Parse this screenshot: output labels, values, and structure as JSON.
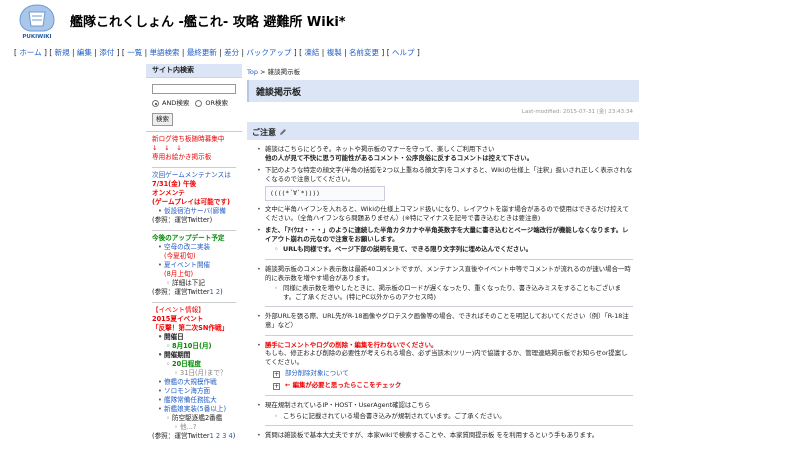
{
  "header": {
    "logo_text": "PUKIWIKI",
    "site_title": "艦隊これくしょん -艦これ- 攻略 避難所 Wiki*"
  },
  "navbar": [
    "ホーム",
    "新規",
    "編集",
    "添付",
    "一覧",
    "単語検索",
    "最終更新",
    "差分",
    "バックアップ",
    "凍結",
    "複製",
    "名前変更",
    "ヘルプ"
  ],
  "sidebar": {
    "search_heading": "サイト内検索",
    "and_label": "AND検索",
    "or_label": "OR検索",
    "search_button": "検索",
    "recruit_line1": "新ログ待ち板随時募集中",
    "recruit_arrows": "↓　↓　↓",
    "recruit_link": "専用お絵かき掲示板",
    "maint_title": "次回ゲームメンテナンスは",
    "maint_date": "7/31(金) 午後",
    "online_title": "オンメンテ",
    "online_note": "(ゲームプレイは可能です)",
    "temp_server": "仮設宿泊サーバ(廊備",
    "source1": "(参照：運営Twitter)",
    "update_title": "今後のアップデート予定",
    "update_item1": "空母の改二実装",
    "update_item1_note": "(今夏初旬)",
    "update_item2": "夏イベント開催",
    "update_item2_note": "(8月上旬)",
    "update_detail": "詳細は下記",
    "source2_prefix": "(参照：運営Twitter",
    "source2_links": "1 2",
    "source2_suffix": ")",
    "event_info": "【イベント情報】",
    "event_title": "2015夏イベント",
    "event_name": "「反撃！第二次SN作戦」",
    "period_label": "開催日",
    "period_date": "8月10日(月)",
    "period_end_label": "開催期間",
    "period_days": "20日程度",
    "period_until": "31日(月)まで？",
    "item_a": "僚艦の大規模作戦",
    "item_b": "ソロモン海方面",
    "item_c": "艦隊常備任務拡大",
    "item_d": "新艦娘実装(5番以上)",
    "item_e": "防空駆逐艦2番艦",
    "item_e_note": "他...?",
    "source3_prefix": "(参照：運営Twitter",
    "source3_links": "1 2 3 4",
    "source3_suffix": ")"
  },
  "main": {
    "breadcrumb_top": "Top",
    "breadcrumb_sep": " > ",
    "breadcrumb_page": "雑談掲示板",
    "page_title": "雑談掲示板",
    "last_modified": "Last-modified: 2015-07-31 (金) 23:43:34",
    "notice_heading": "ご注意",
    "p1_line1": "雑談はこちらにどうぞ。ネットや掲示板のマナーを守って、楽しくご利用下さい",
    "p1_line2": "他の人が見て不快に思う可能性があるコメント・公序良俗に反するコメントは控えて下さい。",
    "p2_text": "下記のような特定の顔文字(半角の括弧を2つ以上重ねる顔文字)をコメすると、Wikiの仕様上「注釈」扱いされ正しく表示されなくなるので注意してください。",
    "code_sample": "((((*´∀`*))))",
    "p3_text": "文中に半角ハイフンを入れると、Wikiの仕様上コマンド扱いになり、レイアウトを崩す場合があるので使用はできるだけ控えてください。（全角ハイフンなら問題ありません）(※特にマイナスを記号で書き込むときは要注意)",
    "p4_text": "また、「ｱｲｳｴｵ・・・」のように連続した半角カタカナや半角英数字を大量に書き込むとページ端改行が機能しなくなります。レイアウト崩れの元なので注意をお願いします。",
    "p4_sub": "URLも同様です。ページ下部の説明を見て、できる限り文字列に埋め込んでください。",
    "p5_text": "雑談掲示板のコメント表示数は最新40コメントですが、メンテナンス直後やイベント中等でコメントが流れるのが速い場合一時的に表示数を増やす場合があります。",
    "p5_sub": "同様に表示数を増やしたときに、掲示板のロードが遅くなったり、重くなったり、書き込みミスをすることもございます。ご了承ください。(特にPC以外からのアクセス時)",
    "p6_text": "外部URLを張る際、URL先がR-18画像やグロテスク画像等の場合、できればそのことを明記しておいてください（例）「R-18注意」など）",
    "p7_line1": "勝手にコメントやログの削除・編集を行わないでください。",
    "p7_line2": "もしも、修正および削除の必要性が考えられる場合、必ず当該木(ツリー)内で協議するか、管理連絡掲示板でお知らせor提案してください。",
    "exp1": "部分削除対象について",
    "exp2": "← 編集が必要と思ったらここをチェック",
    "p8_text": "現在規制されているIP・HOST・UserAgent確認はこちら",
    "p8_sub": "こちらに記載されている場合書き込みが規制されています。ご了承ください。",
    "p9_text": "質問は雑談板で基本大丈夫ですが、本家wikiで検索することや、本家質問提示板 をを利用するという手もあります。"
  }
}
